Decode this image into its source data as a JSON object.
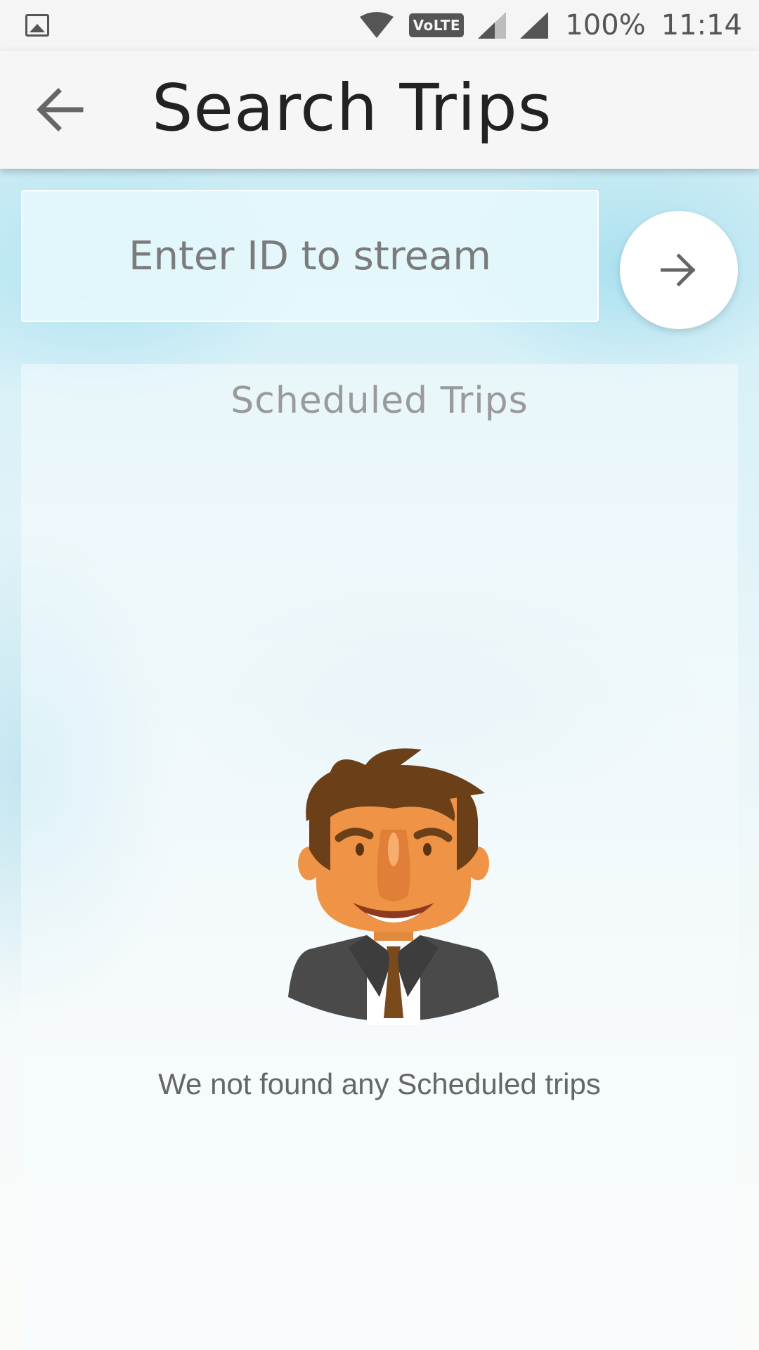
{
  "status_bar": {
    "icons": [
      "gallery-icon",
      "wifi-icon",
      "volte-icon",
      "signal-icon",
      "signal-icon"
    ],
    "volte_label": "VoLTE",
    "battery": "100%",
    "time": "11:14"
  },
  "app_bar": {
    "back_icon": "arrow-left-icon",
    "title": "Search Trips"
  },
  "search": {
    "placeholder": "Enter ID to stream",
    "value": "",
    "submit_icon": "arrow-right-icon"
  },
  "scheduled": {
    "title": "Scheduled Trips",
    "empty_message": "We not found any Scheduled trips",
    "empty_illustration": "businessman-avatar"
  },
  "colors": {
    "accent_bg": "#bfe7f2",
    "title_text": "#222222",
    "muted_text": "#9a9a9a",
    "hair": "#6b3f17",
    "skin": "#ef9347",
    "suit": "#4a4a4a",
    "tie": "#7a4a1c"
  }
}
